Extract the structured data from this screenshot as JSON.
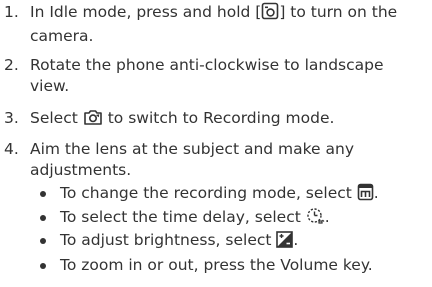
{
  "steps": [
    {
      "number": "1.",
      "before_icon": "In Idle mode, press and hold [",
      "icon": "camera-key-icon",
      "after_icon": "] to turn on the",
      "line2": "camera."
    },
    {
      "number": "2.",
      "line1": "Rotate the phone anti-clockwise to landscape",
      "line2": "view."
    },
    {
      "number": "3.",
      "before_icon": "Select",
      "icon": "camera-switch-icon",
      "after_icon": "to switch to Recording mode."
    },
    {
      "number": "4.",
      "line1": "Aim the lens at the subject and make any",
      "line2": "adjustments."
    }
  ],
  "bullets": [
    {
      "before_icon": "To change the recording mode, select",
      "icon": "recording-mode-icon",
      "after_icon": "."
    },
    {
      "before_icon": "To select the time delay, select",
      "icon": "timer-icon",
      "after_icon": "."
    },
    {
      "before_icon": "To adjust brightness, select",
      "icon": "brightness-icon",
      "after_icon": "."
    },
    {
      "text": "To zoom in or out, press the Volume key."
    }
  ]
}
